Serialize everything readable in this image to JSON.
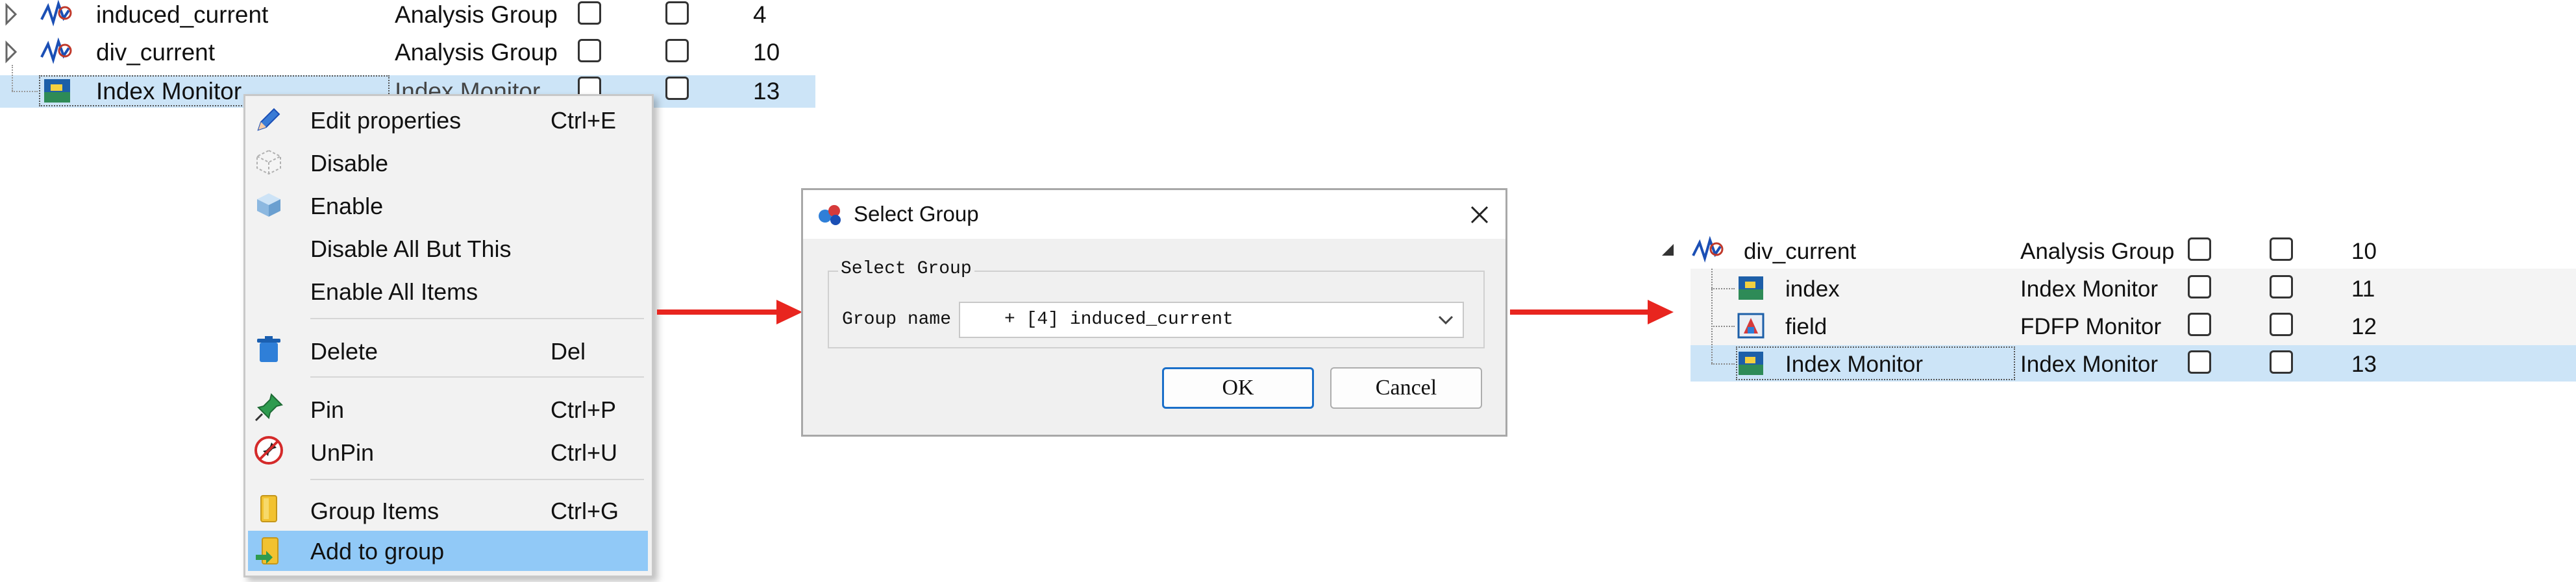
{
  "left_tree": {
    "rows": [
      {
        "name": "induced_current",
        "type": "Analysis Group",
        "id": "4"
      },
      {
        "name": "div_current",
        "type": "Analysis Group",
        "id": "10"
      },
      {
        "name": "Index Monitor",
        "type": "Index Monitor",
        "id": "13"
      }
    ]
  },
  "context_menu": {
    "items": [
      {
        "label": "Edit properties",
        "shortcut": "Ctrl+E",
        "icon": "pencil-icon"
      },
      {
        "label": "Disable",
        "shortcut": "",
        "icon": "disable-cube-icon"
      },
      {
        "label": "Enable",
        "shortcut": "",
        "icon": "enable-cube-icon"
      },
      {
        "label": "Disable All But This",
        "shortcut": "",
        "icon": ""
      },
      {
        "label": "Enable All Items",
        "shortcut": "",
        "icon": ""
      },
      {
        "label": "Delete",
        "shortcut": "Del",
        "icon": "trash-icon"
      },
      {
        "label": "Pin",
        "shortcut": "Ctrl+P",
        "icon": "pin-icon"
      },
      {
        "label": "UnPin",
        "shortcut": "Ctrl+U",
        "icon": "unpin-icon"
      },
      {
        "label": "Group Items",
        "shortcut": "Ctrl+G",
        "icon": "group-icon"
      },
      {
        "label": "Add to group",
        "shortcut": "",
        "icon": "add-to-group-icon"
      }
    ]
  },
  "dialog": {
    "title": "Select Group",
    "group_label": "Select Group",
    "field_label": "Group name",
    "selected_value": "+ [4] induced_current",
    "ok_label": "OK",
    "cancel_label": "Cancel"
  },
  "right_tree": {
    "parent": {
      "name": "div_current",
      "type": "Analysis Group",
      "id": "10"
    },
    "children": [
      {
        "name": "index",
        "type": "Index Monitor",
        "id": "11"
      },
      {
        "name": "field",
        "type": "FDFP Monitor",
        "id": "12"
      },
      {
        "name": "Index Monitor",
        "type": "Index Monitor",
        "id": "13"
      }
    ]
  },
  "colors": {
    "selection": "#cce4f7",
    "menu_highlight": "#91c9f7",
    "arrow": "#e8251f",
    "accent": "#1a6fc9"
  }
}
